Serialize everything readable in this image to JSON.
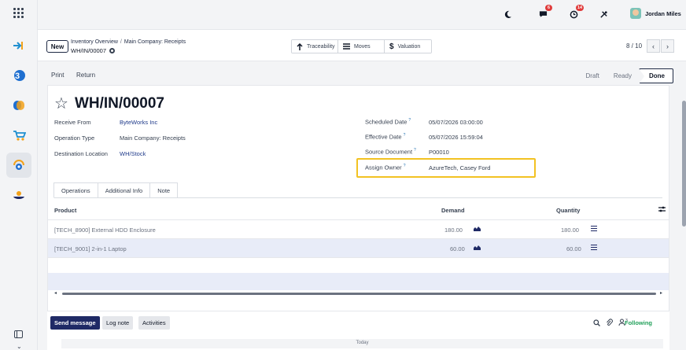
{
  "topbar": {
    "notif_badge": "6",
    "activity_badge": "14",
    "user_name": "Jordan Miles"
  },
  "control_panel": {
    "new_label": "New",
    "breadcrumb_1": "Inventory Overview",
    "breadcrumb_2": "Main Company: Receipts",
    "record_ref": "WH/IN/00007",
    "smart_buttons": [
      "Traceability",
      "Moves",
      "Valuation"
    ],
    "pager": "8 / 10"
  },
  "status": {
    "print_label": "Print",
    "return_label": "Return",
    "stages": [
      "Draft",
      "Ready",
      "Done"
    ],
    "current": "Done"
  },
  "form": {
    "title": "WH/IN/00007",
    "left_fields": [
      {
        "label": "Receive From",
        "value": "ByteWorks Inc"
      },
      {
        "label": "Operation Type",
        "value": "Main Company: Receipts"
      },
      {
        "label": "Destination Location",
        "value": "WH/Stock"
      }
    ],
    "right_fields": [
      {
        "label": "Scheduled Date",
        "value": "05/07/2026 03:00:00"
      },
      {
        "label": "Effective Date",
        "value": "05/07/2026 15:59:04"
      },
      {
        "label": "Source Document",
        "value": "P00010"
      },
      {
        "label": "Assign Owner",
        "value": "AzureTech, Casey Ford"
      }
    ],
    "help_mark": "?"
  },
  "tabs": [
    "Operations",
    "Additional Info",
    "Note"
  ],
  "table": {
    "headers": {
      "product": "Product",
      "demand": "Demand",
      "quantity": "Quantity"
    },
    "rows": [
      {
        "product": "[TECH_8900] External HDD Enclosure",
        "demand": "180.00",
        "quantity": "180.00"
      },
      {
        "product": "[TECH_9001] 2-in-1 Laptop",
        "demand": "60.00",
        "quantity": "60.00"
      }
    ]
  },
  "chatter": {
    "send_message": "Send message",
    "log_note": "Log note",
    "activities": "Activities",
    "followers_count": "3",
    "following": "Following",
    "today": "Today"
  },
  "colors": {
    "accent": "#1f2a66",
    "highlight": "#f2c222",
    "following": "#22a05a",
    "badge": "#e03b3b"
  }
}
